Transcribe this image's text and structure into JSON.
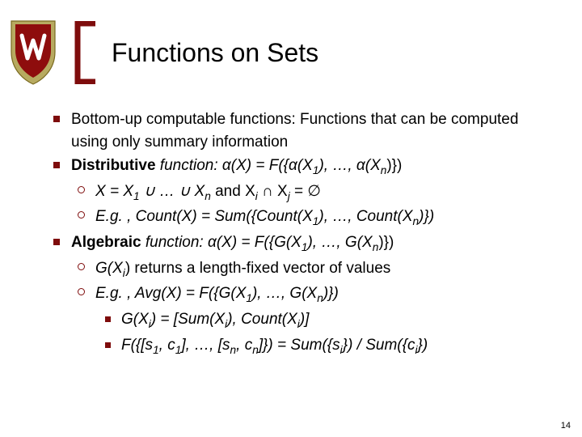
{
  "title": "Functions on Sets",
  "b1": "Bottom-up computable functions: Functions that can be computed using only summary information",
  "b2_prefix": "Distributive",
  "b2_rest": " function: α(X) = F({α(X",
  "b2_r2": "), …, α(X",
  "b2_r3": ")})",
  "b2a_a": "X = X",
  "b2a_b": " ∪ … ∪ X",
  "b2a_c": " and X",
  "b2a_d": " ∩ X",
  "b2a_e": " = ∅",
  "b2b": "E.g. , Count(X) = Sum({Count(X",
  "b2b2": "), …, Count(X",
  "b2b3": ")})",
  "b3_prefix": "Algebraic",
  "b3_rest": " function: α(X) = F({G(X",
  "b3_r2": "), …, G(X",
  "b3_r3": ")})",
  "b3a_a": "G(X",
  "b3a_b": ") returns a length-fixed vector of values",
  "b3b": "E.g. , Avg(X) = F({G(X",
  "b3b2": "), …, G(X",
  "b3b3": ")})",
  "b3b1_a": "G(X",
  "b3b1_b": ") = [Sum(X",
  "b3b1_c": "), Count(X",
  "b3b1_d": ")]",
  "b3b2_a": "F({[s",
  "b3b2_b": ", c",
  "b3b2_c": "], …, [s",
  "b3b2_d": ", c",
  "b3b2_e": "]}) = Sum({s",
  "b3b2_f": "}) / Sum({c",
  "b3b2_g": "})",
  "sub1": "1",
  "subn": "n",
  "subi": "i",
  "subj": "j",
  "pagenum": "14"
}
